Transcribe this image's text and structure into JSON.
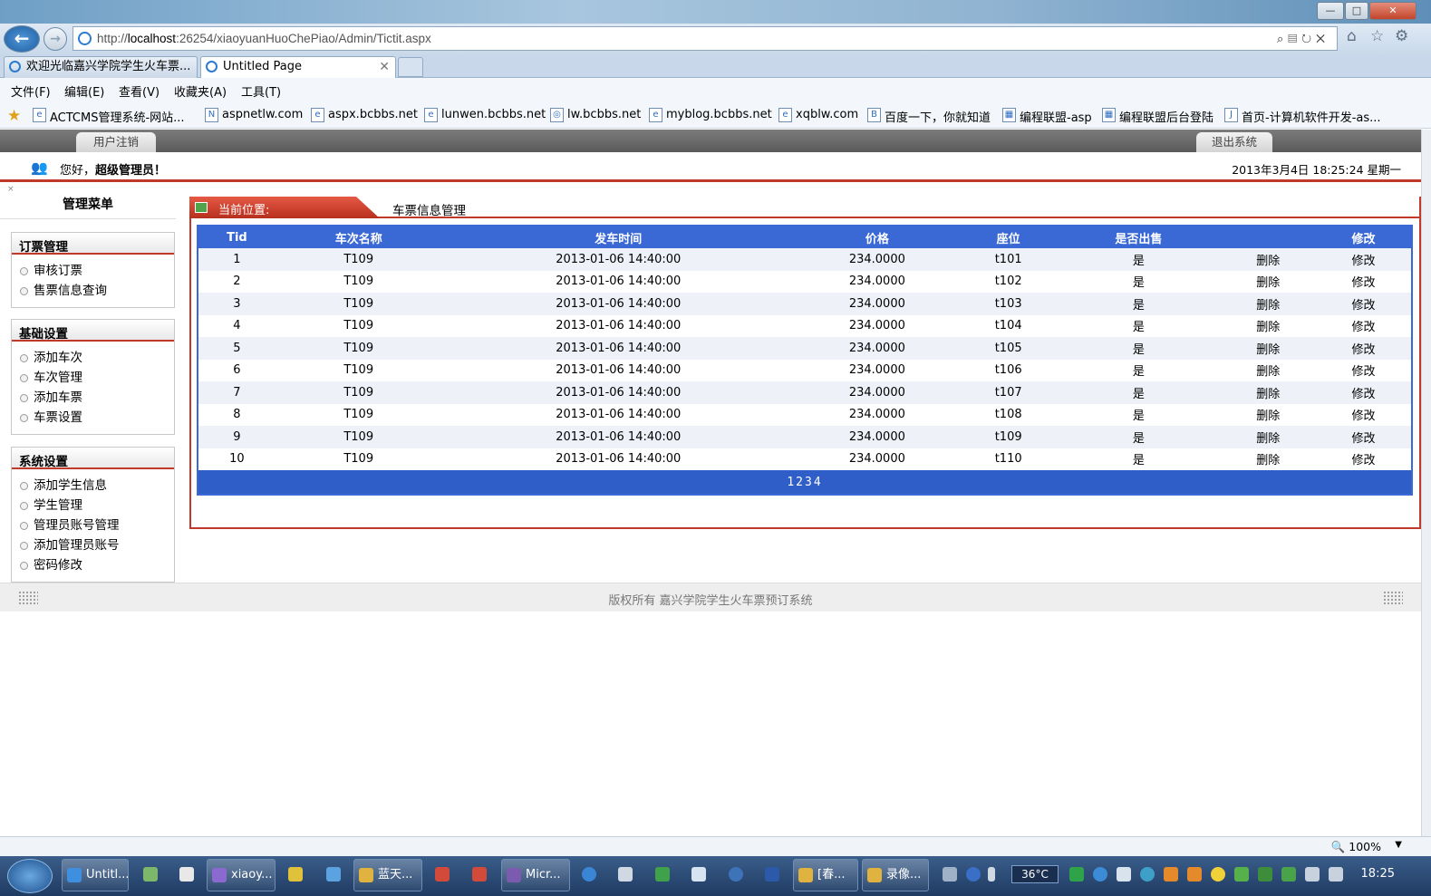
{
  "browser": {
    "address": {
      "prefix": "http://",
      "host": "localhost",
      "rest": ":26254/xiaoyuanHuoChePiao/Admin/Tictit.aspx"
    },
    "tabs": [
      {
        "label": "欢迎光临嘉兴学院学生火车票..."
      },
      {
        "label": "Untitled Page"
      }
    ],
    "menu": [
      "文件(F)",
      "编辑(E)",
      "查看(V)",
      "收藏夹(A)",
      "工具(T)"
    ],
    "favorites": [
      "ACTCMS管理系统-网站...",
      "aspnetlw.com",
      "aspx.bcbbs.net",
      "lunwen.bcbbs.net",
      "lw.bcbbs.net",
      "myblog.bcbbs.net",
      "xqblw.com",
      "百度一下，你就知道",
      "编程联盟-asp",
      "编程联盟后台登陆",
      "首页-计算机软件开发-as..."
    ],
    "zoom": "100%"
  },
  "page": {
    "logout_label": "用户注销",
    "exit_label": "退出系统",
    "greeting": "您好，",
    "user": "超级管理员！",
    "datetime": "2013年3月4日 18:25:24 星期一",
    "sidebar_title": "管理菜单",
    "menu_groups": [
      {
        "title": "订票管理",
        "items": [
          "审核订票",
          "售票信息查询"
        ]
      },
      {
        "title": "基础设置",
        "items": [
          "添加车次",
          "车次管理",
          "添加车票",
          "车票设置"
        ]
      },
      {
        "title": "系统设置",
        "items": [
          "添加学生信息",
          "学生管理",
          "管理员账号管理",
          "添加管理员账号",
          "密码修改"
        ]
      }
    ],
    "crumb_label": "当前位置:",
    "crumb_value": "车票信息管理",
    "table": {
      "headers": [
        "Tid",
        "车次名称",
        "发车时间",
        "价格",
        "座位",
        "是否出售",
        "",
        "修改"
      ],
      "rows": [
        [
          "1",
          "T109",
          "2013-01-06 14:40:00",
          "234.0000",
          "t101",
          "是",
          "删除",
          "修改"
        ],
        [
          "2",
          "T109",
          "2013-01-06 14:40:00",
          "234.0000",
          "t102",
          "是",
          "删除",
          "修改"
        ],
        [
          "3",
          "T109",
          "2013-01-06 14:40:00",
          "234.0000",
          "t103",
          "是",
          "删除",
          "修改"
        ],
        [
          "4",
          "T109",
          "2013-01-06 14:40:00",
          "234.0000",
          "t104",
          "是",
          "删除",
          "修改"
        ],
        [
          "5",
          "T109",
          "2013-01-06 14:40:00",
          "234.0000",
          "t105",
          "是",
          "删除",
          "修改"
        ],
        [
          "6",
          "T109",
          "2013-01-06 14:40:00",
          "234.0000",
          "t106",
          "是",
          "删除",
          "修改"
        ],
        [
          "7",
          "T109",
          "2013-01-06 14:40:00",
          "234.0000",
          "t107",
          "是",
          "删除",
          "修改"
        ],
        [
          "8",
          "T109",
          "2013-01-06 14:40:00",
          "234.0000",
          "t108",
          "是",
          "删除",
          "修改"
        ],
        [
          "9",
          "T109",
          "2013-01-06 14:40:00",
          "234.0000",
          "t109",
          "是",
          "删除",
          "修改"
        ],
        [
          "10",
          "T109",
          "2013-01-06 14:40:00",
          "234.0000",
          "t110",
          "是",
          "删除",
          "修改"
        ]
      ],
      "pager": "1234"
    },
    "footer": "版权所有 嘉兴学院学生火车票预订系统"
  },
  "taskbar": {
    "items": [
      "Untitl...",
      "xiaoy...",
      "蓝天...",
      "Micr...",
      "[春...",
      "录像..."
    ],
    "temperature": "36°C",
    "clock": "18:25"
  },
  "colors": {
    "accent_red": "#c0392b",
    "grid_blue": "#3a68d4"
  }
}
